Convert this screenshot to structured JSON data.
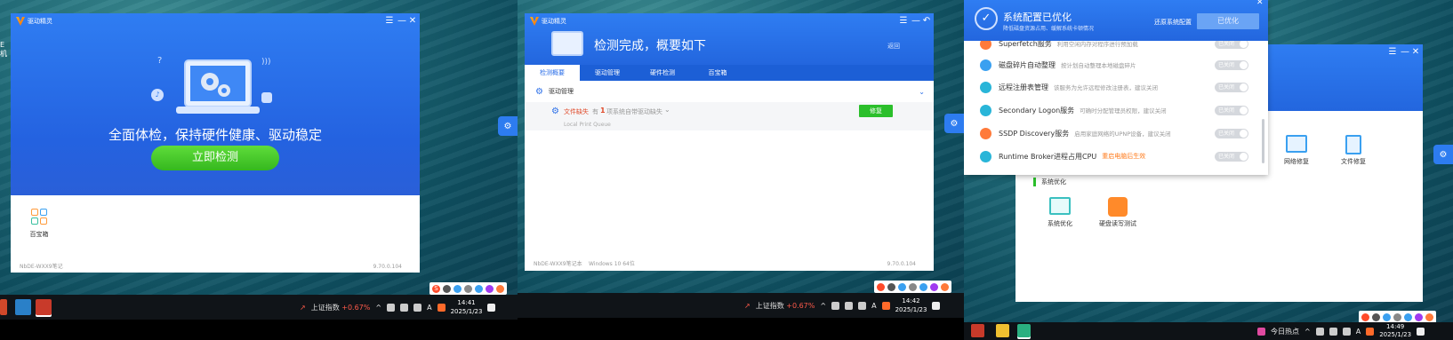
{
  "panel1": {
    "app_title": "驱动精灵",
    "window_buttons": [
      "☰",
      "—",
      "✕"
    ],
    "slogan": "全面体检，保持硬件健康、驱动稳定",
    "scan_button": "立即检测",
    "toolbox_label": "百宝箱",
    "footer_left": "NbDE-WXX9笔记",
    "footer_right": "9.70.0.104",
    "desktop_fragment": "E 机",
    "stock": {
      "name": "上证指数",
      "change": "+0.67%"
    },
    "clock": {
      "time": "14:41",
      "date": "2025/1/23"
    },
    "ime_letter": "A",
    "ime_lang": "S"
  },
  "panel2": {
    "app_title": "驱动精灵",
    "window_buttons": [
      "☰",
      "—",
      "↶"
    ],
    "header_title": "检测完成，概要如下",
    "back_label": "返回",
    "tabs": [
      "检测概要",
      "驱动管理",
      "硬件检测",
      "百宝箱"
    ],
    "section_title": "驱动管理",
    "issue": {
      "label": "文件缺失",
      "prefix": "有",
      "count": "1",
      "suffix": "项系统自带驱动缺失",
      "sub": "Local Print Queue",
      "fix_button": "修复"
    },
    "footer_left": "NbDE-WXX9笔记本",
    "footer_mid": "Windows 10 64位",
    "footer_right": "9.70.0.104",
    "stock": {
      "name": "上证指数",
      "change": "+0.67%"
    },
    "clock": {
      "time": "14:42",
      "date": "2025/1/23"
    },
    "ime_letter": "A"
  },
  "panel3": {
    "popup": {
      "title": "系统配置已优化",
      "subtitle": "降低磁盘资源占用、缓解系统卡顿情况",
      "restore_link": "还原系统配置",
      "optimized_button": "已优化",
      "close": "✕",
      "services": [
        {
          "name": "Superfetch服务",
          "desc": "利用空闲内存对程序进行预加载",
          "state": "已关闭",
          "color": "#ff7a3a"
        },
        {
          "name": "磁盘碎片自动整理",
          "desc": "按计划自动整理本地磁盘碎片",
          "state": "已关闭",
          "color": "#3aa0f0"
        },
        {
          "name": "远程注册表管理",
          "desc": "该服务为允许远程修改注册表，建议关闭",
          "state": "已关闭",
          "color": "#29b5d8"
        },
        {
          "name": "Secondary Logon服务",
          "desc": "可确时分配管理员权限，建议关闭",
          "state": "已关闭",
          "color": "#29b5d8"
        },
        {
          "name": "SSDP Discovery服务",
          "desc": "启用家庭网络的UPNP设备，建议关闭",
          "state": "已关闭",
          "color": "#ff7a3a"
        },
        {
          "name": "Runtime Broker进程占用CPU",
          "desc": "",
          "warn": "重启电脑后生效",
          "state": "已关闭",
          "color": "#29b5d8"
        }
      ]
    },
    "window_buttons": [
      "☰",
      "—",
      "✕"
    ],
    "tools_row1": [
      {
        "label": "网络修复"
      },
      {
        "label": "文件修复"
      }
    ],
    "section_title": "系统优化",
    "tools_row2": [
      {
        "label": "系统优化"
      },
      {
        "label": "硬盘读写测试"
      }
    ],
    "news_label": "今日热点",
    "clock": {
      "time": "14:49",
      "date": "2025/1/23"
    },
    "ime_letter": "A"
  },
  "colors": {
    "brand_blue": "#2a6ee8",
    "scan_green": "#3fcc2e",
    "fix_green": "#2bbf2b",
    "warn_red": "#e04a2a"
  }
}
